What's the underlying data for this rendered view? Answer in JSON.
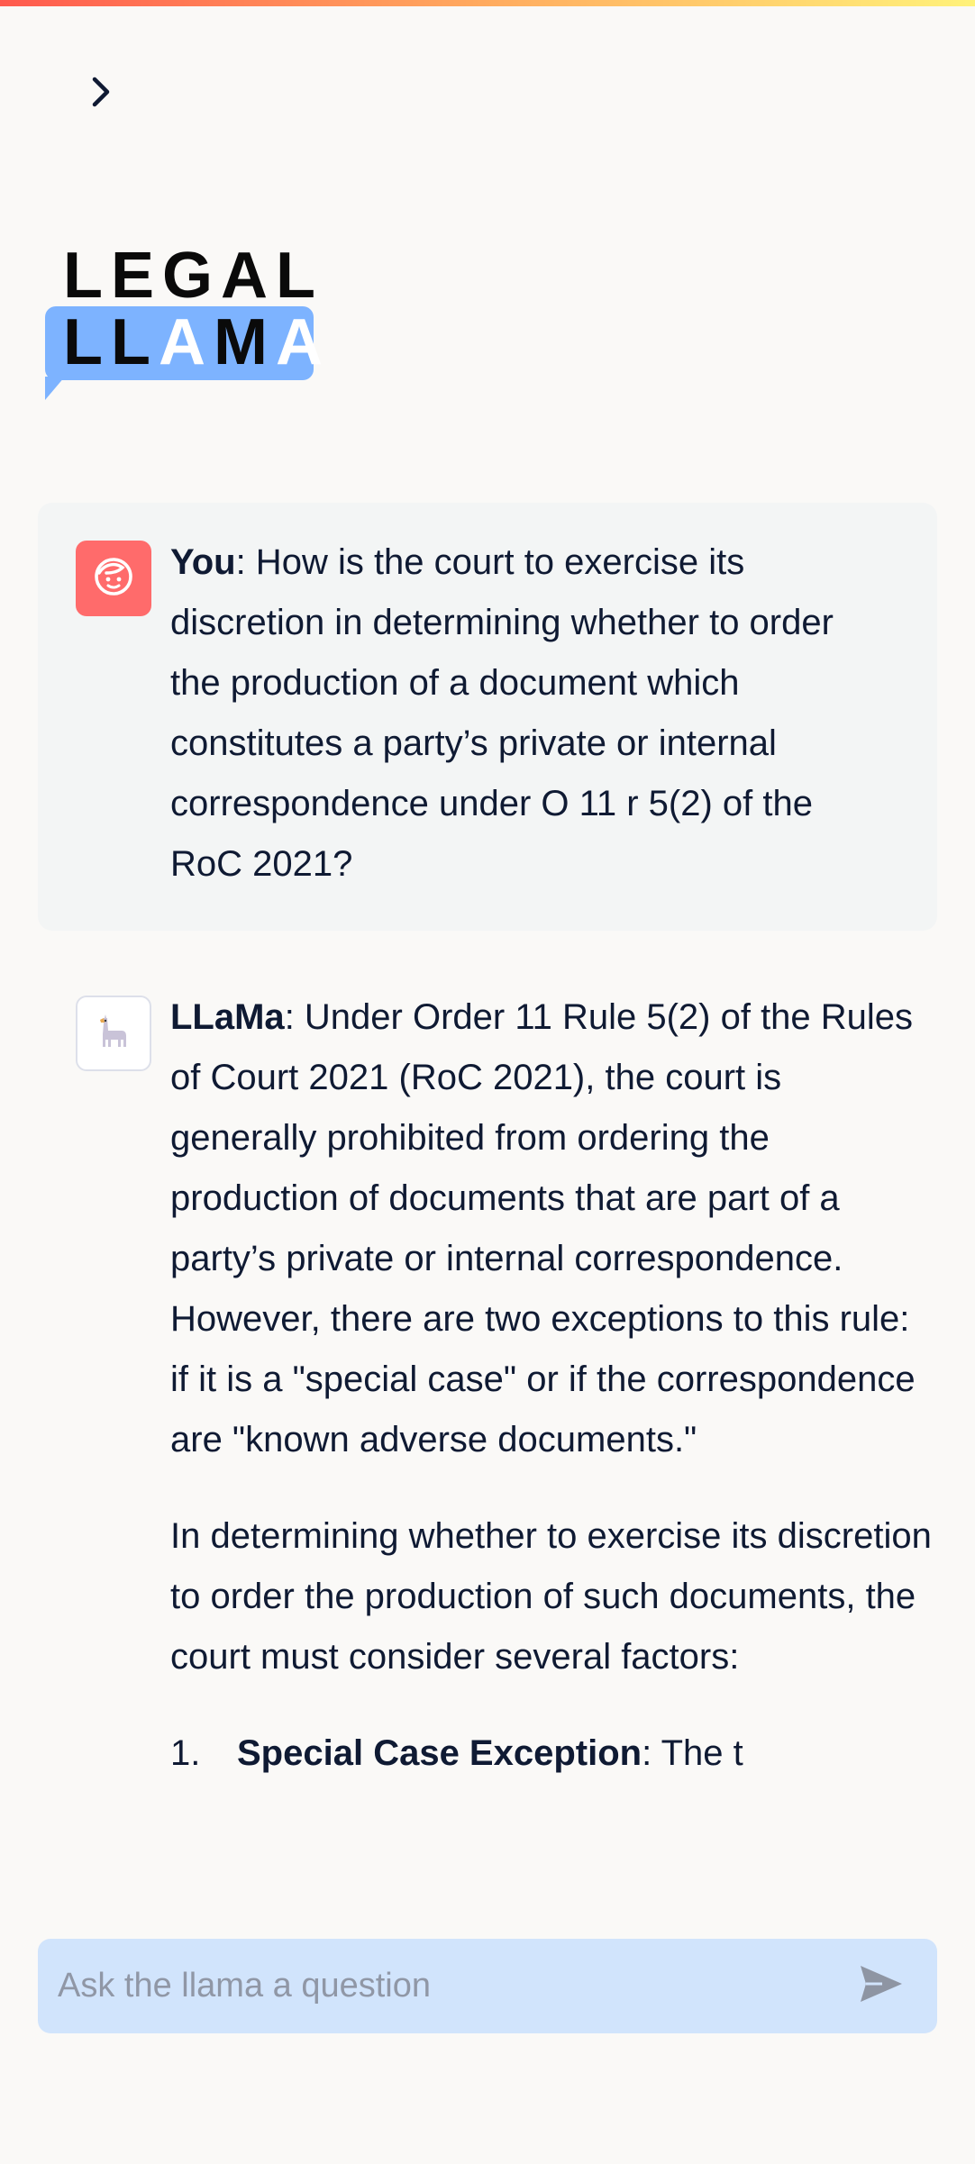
{
  "app": {
    "accent_gradient": [
      "#ff5a4e",
      "#ffab5f",
      "#fff27a"
    ],
    "logo": {
      "line1": "LEGAL",
      "line2_dark": "LL",
      "line2_light_1": "A",
      "line2_dark_2": "M",
      "line2_light_2": "A",
      "bubble_color": "#7db3ff"
    },
    "expand_icon": "chevron-right-icon"
  },
  "chat": {
    "user_message": {
      "sender": "You",
      "avatar_icon": "user-face-icon",
      "avatar_color": "#ff6b6b",
      "text": ": How is the court to exercise its discretion in determining whether to order the production of a document which constitutes a party’s private or internal correspondence under O 11 r 5(2) of the RoC 2021?"
    },
    "bot_message": {
      "sender": "LLaMa",
      "avatar_icon": "llama-icon",
      "paragraph1": ": Under Order 11 Rule 5(2) of the Rules of Court 2021 (RoC 2021), the court is generally prohibited from ordering the production of documents that are part of a party’s private or internal correspondence. However, there are two exceptions to this rule: if it is a \"special case\" or if the correspondence are \"known adverse documents.\"",
      "paragraph2": "In determining whether to exercise its discretion to order the production of such documents, the court must consider several factors:",
      "list": [
        {
          "num": "1.",
          "title": "Special Case Exception",
          "rest": ": The t"
        }
      ]
    }
  },
  "input": {
    "placeholder": "Ask the llama a question",
    "value": "",
    "send_icon": "send-icon"
  }
}
